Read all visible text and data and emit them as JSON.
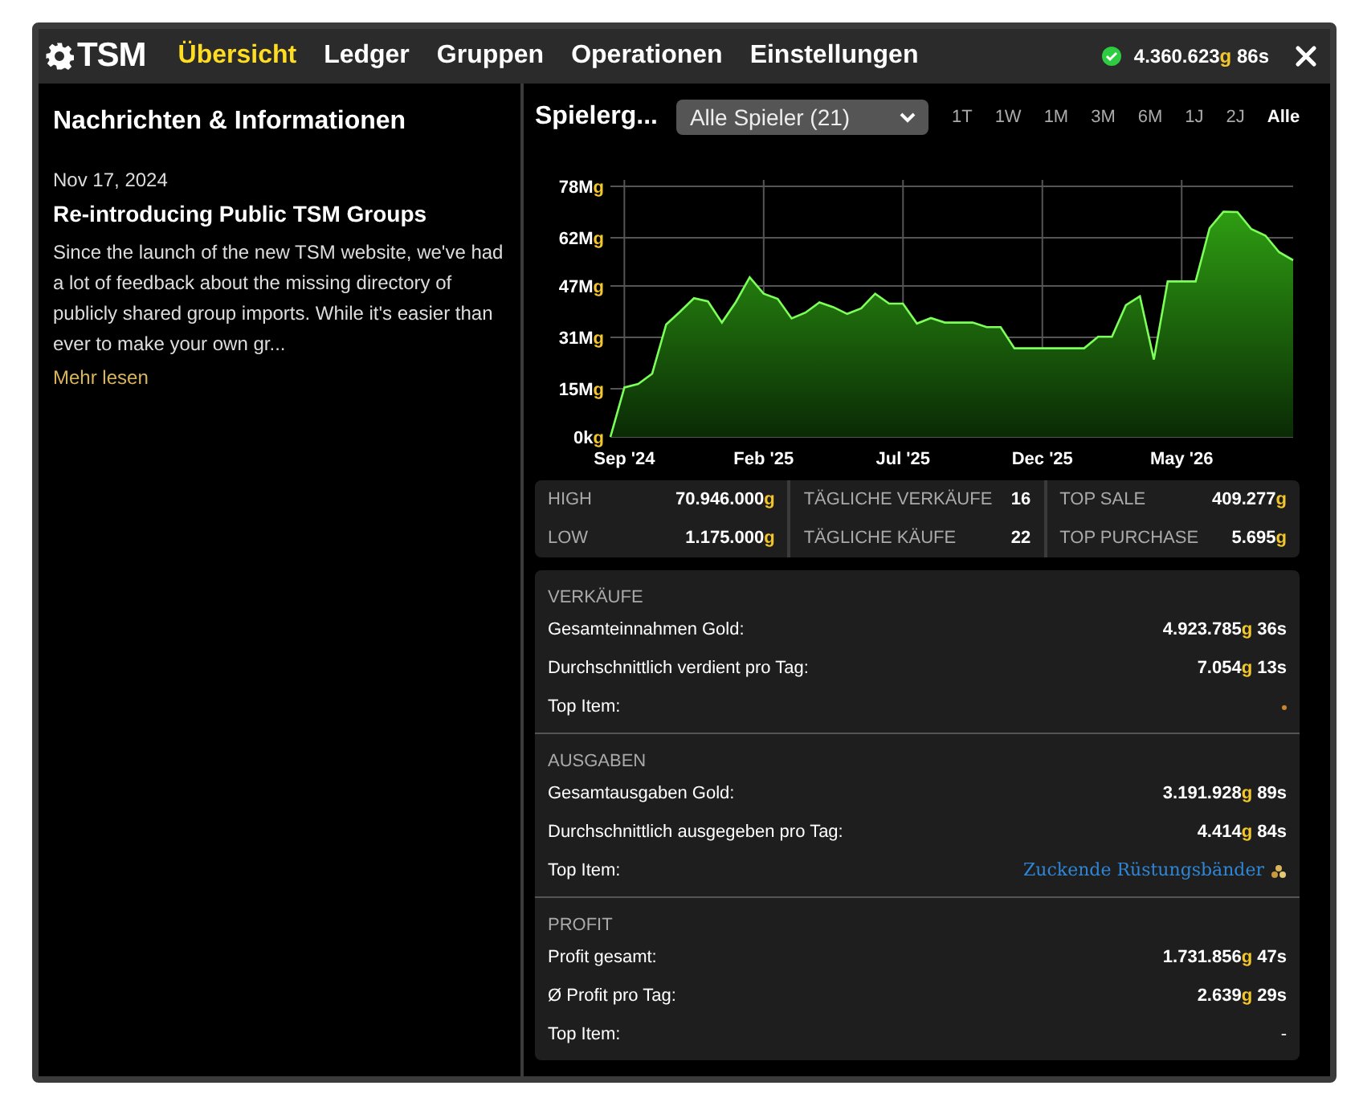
{
  "header": {
    "logo": "TSM",
    "tabs": [
      {
        "label": "Übersicht",
        "selected": true
      },
      {
        "label": "Ledger",
        "selected": false
      },
      {
        "label": "Gruppen",
        "selected": false
      },
      {
        "label": "Operationen",
        "selected": false
      },
      {
        "label": "Einstellungen",
        "selected": false
      }
    ],
    "balance": {
      "value": "4.360.623",
      "unit": "g",
      "extra": "86s"
    },
    "online": true
  },
  "news": {
    "title": "Nachrichten & Informationen",
    "date": "Nov 17, 2024",
    "headline": "Re-introducing Public TSM Groups",
    "body": "Since the launch of the new TSM website, we've had a lot of feedback about the missing directory of publicly shared group imports. While it's easier than ever to make your own gr...",
    "link": "Mehr lesen"
  },
  "player_chart": {
    "title": "Spielerg...",
    "player_select": {
      "value": "Alle Spieler (21)"
    },
    "ranges": [
      {
        "label": "1T",
        "selected": false
      },
      {
        "label": "1W",
        "selected": false
      },
      {
        "label": "1M",
        "selected": false
      },
      {
        "label": "3M",
        "selected": false
      },
      {
        "label": "6M",
        "selected": false
      },
      {
        "label": "1J",
        "selected": false
      },
      {
        "label": "2J",
        "selected": false
      },
      {
        "label": "Alle",
        "selected": true
      }
    ],
    "chart_data": {
      "type": "area",
      "grid": true,
      "ylim": [
        0,
        78
      ],
      "categories": [
        null,
        "Sep '24",
        null,
        null,
        null,
        null,
        null,
        null,
        null,
        null,
        null,
        "Feb '25",
        null,
        null,
        null,
        null,
        null,
        null,
        null,
        null,
        null,
        "Jul '25",
        null,
        null,
        null,
        null,
        null,
        null,
        null,
        null,
        null,
        "Dec '25",
        null,
        null,
        null,
        null,
        null,
        null,
        null,
        null,
        null,
        "May '26",
        null,
        null,
        null,
        null,
        null,
        null,
        null,
        null
      ],
      "yticks": [
        {
          "value": 0,
          "label": "0kg"
        },
        {
          "value": 15,
          "label": "15Mg"
        },
        {
          "value": 31,
          "label": "31Mg"
        },
        {
          "value": 47,
          "label": "47Mg"
        },
        {
          "value": 62,
          "label": "62Mg"
        },
        {
          "value": 78,
          "label": "78Mg"
        }
      ],
      "series": [
        {
          "color": "#7dff5a",
          "values": [
            0,
            15.4,
            16.5,
            19.7,
            35,
            39,
            43.2,
            42.2,
            35.6,
            42,
            49.7,
            44.6,
            43,
            36.9,
            38.7,
            41.9,
            40.4,
            38.3,
            40,
            44.6,
            41.5,
            41.5,
            35.3,
            37,
            35.6,
            35.6,
            35.6,
            34.2,
            34.2,
            27.6,
            27.6,
            27.6,
            27.6,
            27.6,
            27.6,
            31.2,
            31.2,
            41,
            43.8,
            24.1,
            48.4,
            48.4,
            48.4,
            65,
            70.1,
            70,
            64.7,
            62.7,
            57.5,
            55
          ]
        }
      ]
    }
  },
  "stats": [
    [
      {
        "label": "HIGH",
        "value": {
          "value": "70.946.000",
          "unit": "g"
        }
      },
      {
        "label": "LOW",
        "value": {
          "value": "1.175.000",
          "unit": "g"
        }
      }
    ],
    [
      {
        "label": "TÄGLICHE VERKÄUFE",
        "value": {
          "value": "16"
        }
      },
      {
        "label": "TÄGLICHE KÄUFE",
        "value": {
          "value": "22"
        }
      }
    ],
    [
      {
        "label": "TOP SALE",
        "value": {
          "value": "409.277",
          "unit": "g"
        }
      },
      {
        "label": "TOP PURCHASE",
        "value": {
          "value": "5.695",
          "unit": "g"
        }
      }
    ]
  ],
  "sections": [
    {
      "title": "VERKÄUFE",
      "rows": [
        {
          "kind": "money",
          "label": "Gesamteinnahmen Gold:",
          "value": {
            "value": "4.923.785",
            "unit": "g",
            "extra": "36s"
          }
        },
        {
          "kind": "money",
          "label": "Durchschnittlich verdient pro Tag:",
          "value": {
            "value": "7.054",
            "unit": "g",
            "extra": "13s"
          }
        },
        {
          "kind": "dot",
          "label": "Top Item:"
        }
      ]
    },
    {
      "title": "AUSGABEN",
      "rows": [
        {
          "kind": "money",
          "label": "Gesamtausgaben Gold:",
          "value": {
            "value": "3.191.928",
            "unit": "g",
            "extra": "89s"
          }
        },
        {
          "kind": "money",
          "label": "Durchschnittlich ausgegeben pro Tag:",
          "value": {
            "value": "4.414",
            "unit": "g",
            "extra": "84s"
          }
        },
        {
          "kind": "item",
          "label": "Top Item:",
          "item": "Zuckende Rüstungsbänder"
        }
      ]
    },
    {
      "title": "PROFIT",
      "rows": [
        {
          "kind": "money",
          "label": "Profit gesamt:",
          "value": {
            "value": "1.731.856",
            "unit": "g",
            "extra": "47s"
          }
        },
        {
          "kind": "money",
          "label": "Ø Profit pro Tag:",
          "value": {
            "value": "2.639",
            "unit": "g",
            "extra": "29s"
          }
        },
        {
          "kind": "text",
          "label": "Top Item:",
          "text": "-"
        }
      ]
    }
  ]
}
